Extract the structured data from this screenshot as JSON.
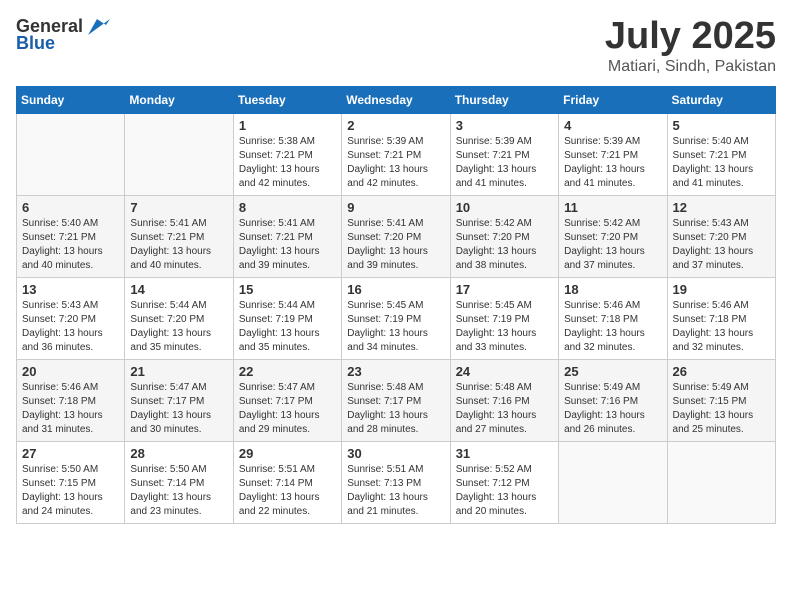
{
  "logo": {
    "general": "General",
    "blue": "Blue"
  },
  "header": {
    "month": "July 2025",
    "location": "Matiari, Sindh, Pakistan"
  },
  "weekdays": [
    "Sunday",
    "Monday",
    "Tuesday",
    "Wednesday",
    "Thursday",
    "Friday",
    "Saturday"
  ],
  "weeks": [
    [
      {
        "day": "",
        "info": ""
      },
      {
        "day": "",
        "info": ""
      },
      {
        "day": "1",
        "info": "Sunrise: 5:38 AM\nSunset: 7:21 PM\nDaylight: 13 hours and 42 minutes."
      },
      {
        "day": "2",
        "info": "Sunrise: 5:39 AM\nSunset: 7:21 PM\nDaylight: 13 hours and 42 minutes."
      },
      {
        "day": "3",
        "info": "Sunrise: 5:39 AM\nSunset: 7:21 PM\nDaylight: 13 hours and 41 minutes."
      },
      {
        "day": "4",
        "info": "Sunrise: 5:39 AM\nSunset: 7:21 PM\nDaylight: 13 hours and 41 minutes."
      },
      {
        "day": "5",
        "info": "Sunrise: 5:40 AM\nSunset: 7:21 PM\nDaylight: 13 hours and 41 minutes."
      }
    ],
    [
      {
        "day": "6",
        "info": "Sunrise: 5:40 AM\nSunset: 7:21 PM\nDaylight: 13 hours and 40 minutes."
      },
      {
        "day": "7",
        "info": "Sunrise: 5:41 AM\nSunset: 7:21 PM\nDaylight: 13 hours and 40 minutes."
      },
      {
        "day": "8",
        "info": "Sunrise: 5:41 AM\nSunset: 7:21 PM\nDaylight: 13 hours and 39 minutes."
      },
      {
        "day": "9",
        "info": "Sunrise: 5:41 AM\nSunset: 7:20 PM\nDaylight: 13 hours and 39 minutes."
      },
      {
        "day": "10",
        "info": "Sunrise: 5:42 AM\nSunset: 7:20 PM\nDaylight: 13 hours and 38 minutes."
      },
      {
        "day": "11",
        "info": "Sunrise: 5:42 AM\nSunset: 7:20 PM\nDaylight: 13 hours and 37 minutes."
      },
      {
        "day": "12",
        "info": "Sunrise: 5:43 AM\nSunset: 7:20 PM\nDaylight: 13 hours and 37 minutes."
      }
    ],
    [
      {
        "day": "13",
        "info": "Sunrise: 5:43 AM\nSunset: 7:20 PM\nDaylight: 13 hours and 36 minutes."
      },
      {
        "day": "14",
        "info": "Sunrise: 5:44 AM\nSunset: 7:20 PM\nDaylight: 13 hours and 35 minutes."
      },
      {
        "day": "15",
        "info": "Sunrise: 5:44 AM\nSunset: 7:19 PM\nDaylight: 13 hours and 35 minutes."
      },
      {
        "day": "16",
        "info": "Sunrise: 5:45 AM\nSunset: 7:19 PM\nDaylight: 13 hours and 34 minutes."
      },
      {
        "day": "17",
        "info": "Sunrise: 5:45 AM\nSunset: 7:19 PM\nDaylight: 13 hours and 33 minutes."
      },
      {
        "day": "18",
        "info": "Sunrise: 5:46 AM\nSunset: 7:18 PM\nDaylight: 13 hours and 32 minutes."
      },
      {
        "day": "19",
        "info": "Sunrise: 5:46 AM\nSunset: 7:18 PM\nDaylight: 13 hours and 32 minutes."
      }
    ],
    [
      {
        "day": "20",
        "info": "Sunrise: 5:46 AM\nSunset: 7:18 PM\nDaylight: 13 hours and 31 minutes."
      },
      {
        "day": "21",
        "info": "Sunrise: 5:47 AM\nSunset: 7:17 PM\nDaylight: 13 hours and 30 minutes."
      },
      {
        "day": "22",
        "info": "Sunrise: 5:47 AM\nSunset: 7:17 PM\nDaylight: 13 hours and 29 minutes."
      },
      {
        "day": "23",
        "info": "Sunrise: 5:48 AM\nSunset: 7:17 PM\nDaylight: 13 hours and 28 minutes."
      },
      {
        "day": "24",
        "info": "Sunrise: 5:48 AM\nSunset: 7:16 PM\nDaylight: 13 hours and 27 minutes."
      },
      {
        "day": "25",
        "info": "Sunrise: 5:49 AM\nSunset: 7:16 PM\nDaylight: 13 hours and 26 minutes."
      },
      {
        "day": "26",
        "info": "Sunrise: 5:49 AM\nSunset: 7:15 PM\nDaylight: 13 hours and 25 minutes."
      }
    ],
    [
      {
        "day": "27",
        "info": "Sunrise: 5:50 AM\nSunset: 7:15 PM\nDaylight: 13 hours and 24 minutes."
      },
      {
        "day": "28",
        "info": "Sunrise: 5:50 AM\nSunset: 7:14 PM\nDaylight: 13 hours and 23 minutes."
      },
      {
        "day": "29",
        "info": "Sunrise: 5:51 AM\nSunset: 7:14 PM\nDaylight: 13 hours and 22 minutes."
      },
      {
        "day": "30",
        "info": "Sunrise: 5:51 AM\nSunset: 7:13 PM\nDaylight: 13 hours and 21 minutes."
      },
      {
        "day": "31",
        "info": "Sunrise: 5:52 AM\nSunset: 7:12 PM\nDaylight: 13 hours and 20 minutes."
      },
      {
        "day": "",
        "info": ""
      },
      {
        "day": "",
        "info": ""
      }
    ]
  ]
}
